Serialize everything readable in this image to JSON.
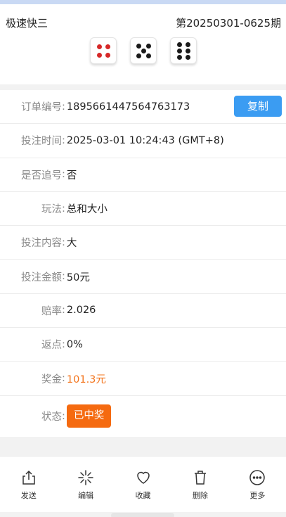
{
  "header": {
    "lottery_name": "极速快三",
    "issue": "第20250301-0625期",
    "dice": [
      4,
      5,
      6
    ]
  },
  "detail": {
    "rows": [
      {
        "label": "订单编号",
        "value": "1895661447564763173"
      },
      {
        "label": "投注时间",
        "value": "2025-03-01 10:24:43 (GMT+8)"
      },
      {
        "label": "是否追号",
        "value": "否"
      },
      {
        "label": "玩法",
        "value": "总和大小"
      },
      {
        "label": "投注内容",
        "value": "大"
      },
      {
        "label": "投注金额",
        "value": "50元"
      },
      {
        "label": "赔率",
        "value": "2.026"
      },
      {
        "label": "返点",
        "value": "0%"
      },
      {
        "label": "奖金",
        "value": "101.3元"
      },
      {
        "label": "状态",
        "value": "已中奖"
      }
    ],
    "copy_label": "复制",
    "colon": ":"
  },
  "toolbar": {
    "items": [
      {
        "label": "发送",
        "icon": "share-icon"
      },
      {
        "label": "编辑",
        "icon": "edit-icon"
      },
      {
        "label": "收藏",
        "icon": "heart-icon"
      },
      {
        "label": "删除",
        "icon": "trash-icon"
      },
      {
        "label": "更多",
        "icon": "more-icon"
      }
    ]
  },
  "colors": {
    "accent_blue": "#3b9cf2",
    "win_orange": "#f56a10",
    "prize_orange": "#f3731a",
    "pip_red": "#d62828"
  }
}
